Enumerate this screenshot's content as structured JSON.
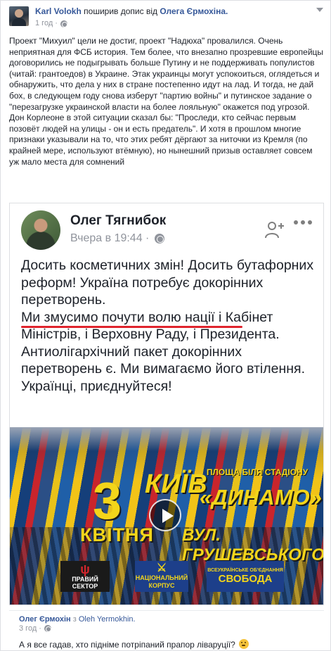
{
  "post": {
    "author": "Karl Volokh",
    "action": "поширив допис від",
    "source_page": "Олега Єрмохіна.",
    "time": "1 год",
    "privacy_icon": "globe-icon",
    "menu_icon": "chevron-down-icon",
    "body": [
      "Проект \"Михуил\" цели не достиг, проект \"Надюха\" провалился. Очень неприятная для ФСБ история. Тем более, что внезапно прозревшие европейцы договорились не подыгрывать больше Путину и не поддерживать популистов (читай: грантоедов) в Украине. Этак украинцы могут успокоиться, оглядеться и обнаружить, что дела у них в стране постепенно идут на лад. И тогда, не дай бох, в следующем году снова изберут \"партию войны\" и путинское задание о \"перезагрузке украинской власти на более лояльную\" окажется под угрозой.",
      "Дон Корлеоне в этой ситуации сказал бы: \"Проследи, кто сейчас первым позовёт людей на улицы - он и есть предатель\". И хотя в прошлом многие признаки указывали на то, что этих ребят дёргают за ниточки из Кремля (по крайней мере, используют втёмную), но нынешний призыв оставляет совсем уж мало места для сомнений"
    ]
  },
  "shared": {
    "name": "Олег Тягнибок",
    "time": "Вчера в 19:44 ·",
    "add_friend_icon": "add-friend-icon",
    "more_icon": "more-icon",
    "text_before": "Досить косметичних змін! Досить бутафорних реформ! Україна потребує докорінних перетворень.",
    "text_underlined": "Ми змусимо почути волю нації",
    "text_after": " і Кабінет Міністрів, і Верховну Раду, і Президента.",
    "text_2": "Антиолігархічний пакет докорінних перетворень є. Ми вимагаємо його втілення.",
    "text_3": "Українці, приєднуйтеся!",
    "video": {
      "day": "3",
      "month": "КВІТНЯ",
      "city": "КИЇВ",
      "place_line": "ПЛОЩА БІЛЯ СТАДІОНУ",
      "stadium": "«ДИНАМО»",
      "street": "ВУЛ. ГРУШЕВСЬКОГО,3",
      "logo_1": "ПРАВИЙ СЕКТОР",
      "logo_2": "НАЦІОНАЛЬНИЙ КОРПУС",
      "logo_3_small": "ВСЕУКРАЇНСЬКЕ ОБ'ЄДНАННЯ",
      "logo_3": "СВОБОДА",
      "play_icon": "play-icon"
    }
  },
  "comment": {
    "author": "Олег Єрмохін",
    "via": "з",
    "via_link": "Oleh Yermokhin.",
    "time": "3 год",
    "text": "А я все гадав, хто підніме потріпаний прапор ліваруції?",
    "emoji_icon": "thinking-face-icon"
  }
}
